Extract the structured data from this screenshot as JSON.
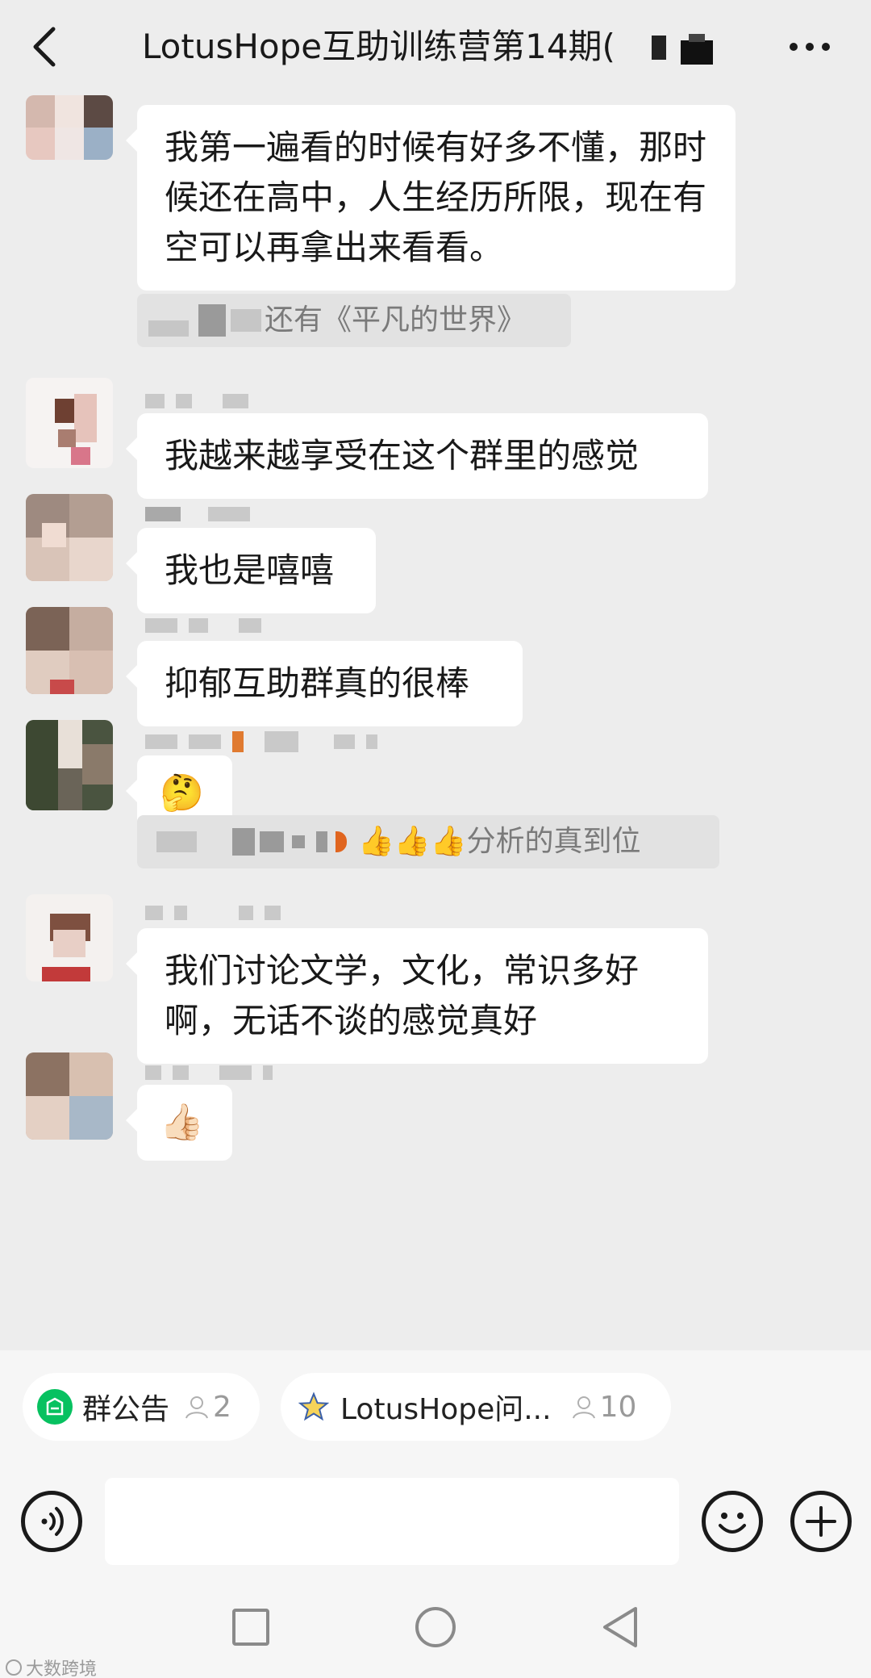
{
  "header": {
    "title": "LotusHope互助训练营第14期(",
    "back_icon": "chevron-left-icon",
    "more_icon": "more-horizontal-icon"
  },
  "messages": [
    {
      "type": "text",
      "text": "我第一遍看的时候有好多不懂，那时候还在高中，人生经历所限，现在有空可以再拿出来看看。"
    },
    {
      "type": "quote",
      "text": "还有《平凡的世界》"
    },
    {
      "type": "text",
      "text": "我越来越享受在这个群里的感觉"
    },
    {
      "type": "text",
      "text": "我也是嘻嘻"
    },
    {
      "type": "text",
      "text": "抑郁互助群真的很棒"
    },
    {
      "type": "emoji",
      "text": "🤔"
    },
    {
      "type": "quote",
      "text": "👍👍👍分析的真到位"
    },
    {
      "type": "text",
      "text": "我们讨论文学，文化，常识多好啊，无话不谈的感觉真好"
    },
    {
      "type": "emoji",
      "text": "👍🏻"
    }
  ],
  "chips": [
    {
      "label": "群公告",
      "count": "2",
      "icon": "announcement-icon",
      "icon_color": "#07c160"
    },
    {
      "label": "LotusHope问...",
      "count": "10",
      "icon": "star-icon",
      "icon_color": "#f2c230"
    }
  ],
  "input": {
    "placeholder": ""
  },
  "watermark": "大数跨境",
  "colors": {
    "background": "#ededed",
    "bubble": "#ffffff",
    "quote_bg": "#e2e2e2",
    "accent": "#07c160"
  }
}
